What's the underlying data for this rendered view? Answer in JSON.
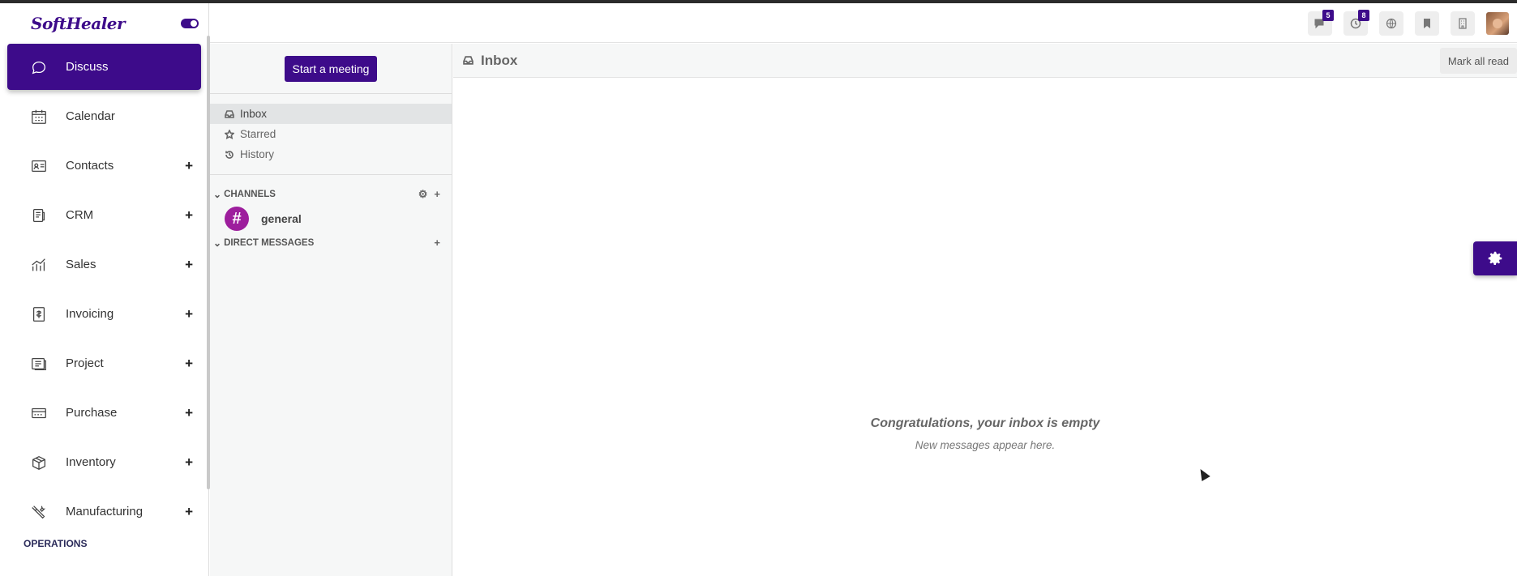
{
  "brand": {
    "name": "SoftHealer"
  },
  "menu": [
    {
      "label": "Discuss",
      "icon": "chat-icon",
      "active": true,
      "has_plus": false
    },
    {
      "label": "Calendar",
      "icon": "calendar-icon",
      "active": false,
      "has_plus": false
    },
    {
      "label": "Contacts",
      "icon": "contacts-icon",
      "active": false,
      "has_plus": true
    },
    {
      "label": "CRM",
      "icon": "crm-icon",
      "active": false,
      "has_plus": true
    },
    {
      "label": "Sales",
      "icon": "sales-icon",
      "active": false,
      "has_plus": true
    },
    {
      "label": "Invoicing",
      "icon": "invoicing-icon",
      "active": false,
      "has_plus": true
    },
    {
      "label": "Project",
      "icon": "project-icon",
      "active": false,
      "has_plus": true
    },
    {
      "label": "Purchase",
      "icon": "purchase-icon",
      "active": false,
      "has_plus": true
    },
    {
      "label": "Inventory",
      "icon": "inventory-icon",
      "active": false,
      "has_plus": true
    },
    {
      "label": "Manufacturing",
      "icon": "manufacturing-icon",
      "active": false,
      "has_plus": true
    }
  ],
  "menu_plus": "+",
  "section_operations": "OPERATIONS",
  "systray": {
    "messages_count": "5",
    "activities_count": "8"
  },
  "discuss": {
    "start_meeting": "Start a meeting",
    "mailboxes": [
      {
        "label": "Inbox",
        "active": true
      },
      {
        "label": "Starred",
        "active": false
      },
      {
        "label": "History",
        "active": false
      }
    ],
    "channels_header": "CHANNELS",
    "channels": [
      {
        "name": "general",
        "avatar": "#"
      }
    ],
    "dm_header": "DIRECT MESSAGES",
    "add": "+"
  },
  "main": {
    "title": "Inbox",
    "mark_all_read": "Mark all read",
    "empty_title": "Congratulations, your inbox is empty",
    "empty_sub": "New messages appear here."
  },
  "colors": {
    "brand": "#3d0b8a",
    "channel_avatar": "#9d1e9d"
  }
}
